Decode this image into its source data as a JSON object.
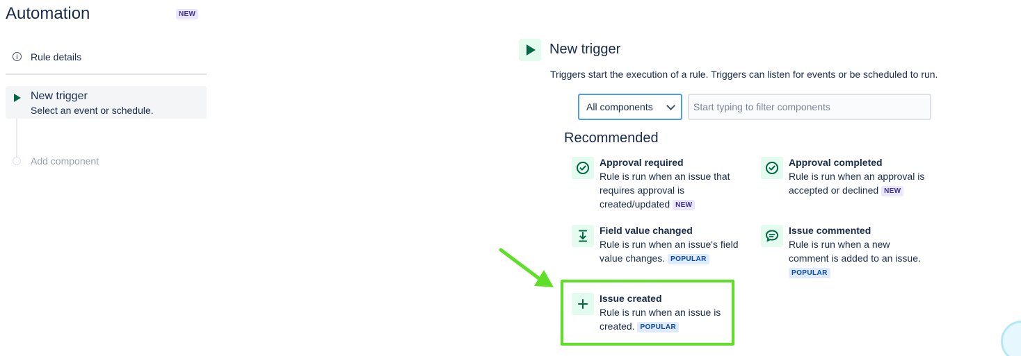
{
  "sidebar": {
    "app_title": "Automation",
    "app_badge": "NEW",
    "rule_details_label": "Rule details",
    "trigger_title": "New trigger",
    "trigger_subtitle": "Select an event or schedule.",
    "add_component_label": "Add component"
  },
  "panel": {
    "title": "New trigger",
    "description": "Triggers start the execution of a rule. Triggers can listen for events or be scheduled to run.",
    "select_value": "All components",
    "filter_placeholder": "Start typing to filter components",
    "recommended_heading": "Recommended"
  },
  "cards": {
    "approval_required": {
      "title": "Approval required",
      "desc": "Rule is run when an issue that requires approval is created/updated",
      "badge": "NEW",
      "icon": "check-circle-icon"
    },
    "approval_completed": {
      "title": "Approval completed",
      "desc": "Rule is run when an approval is accepted or declined",
      "badge": "NEW",
      "icon": "check-circle-icon"
    },
    "field_value_changed": {
      "title": "Field value changed",
      "desc": "Rule is run when an issue's field value changes.",
      "badge": "POPULAR",
      "icon": "download-arrow-icon"
    },
    "issue_commented": {
      "title": "Issue commented",
      "desc": "Rule is run when a new comment is added to an issue.",
      "badge": "POPULAR",
      "icon": "comment-icon"
    },
    "issue_created": {
      "title": "Issue created",
      "desc": "Rule is run when an issue is created.",
      "badge": "POPULAR",
      "icon": "plus-icon"
    }
  },
  "colors": {
    "accent_green": "#006644",
    "icon_bg": "#e3fcef",
    "highlight": "#5fe028",
    "focus_blue": "#4c9aff"
  }
}
